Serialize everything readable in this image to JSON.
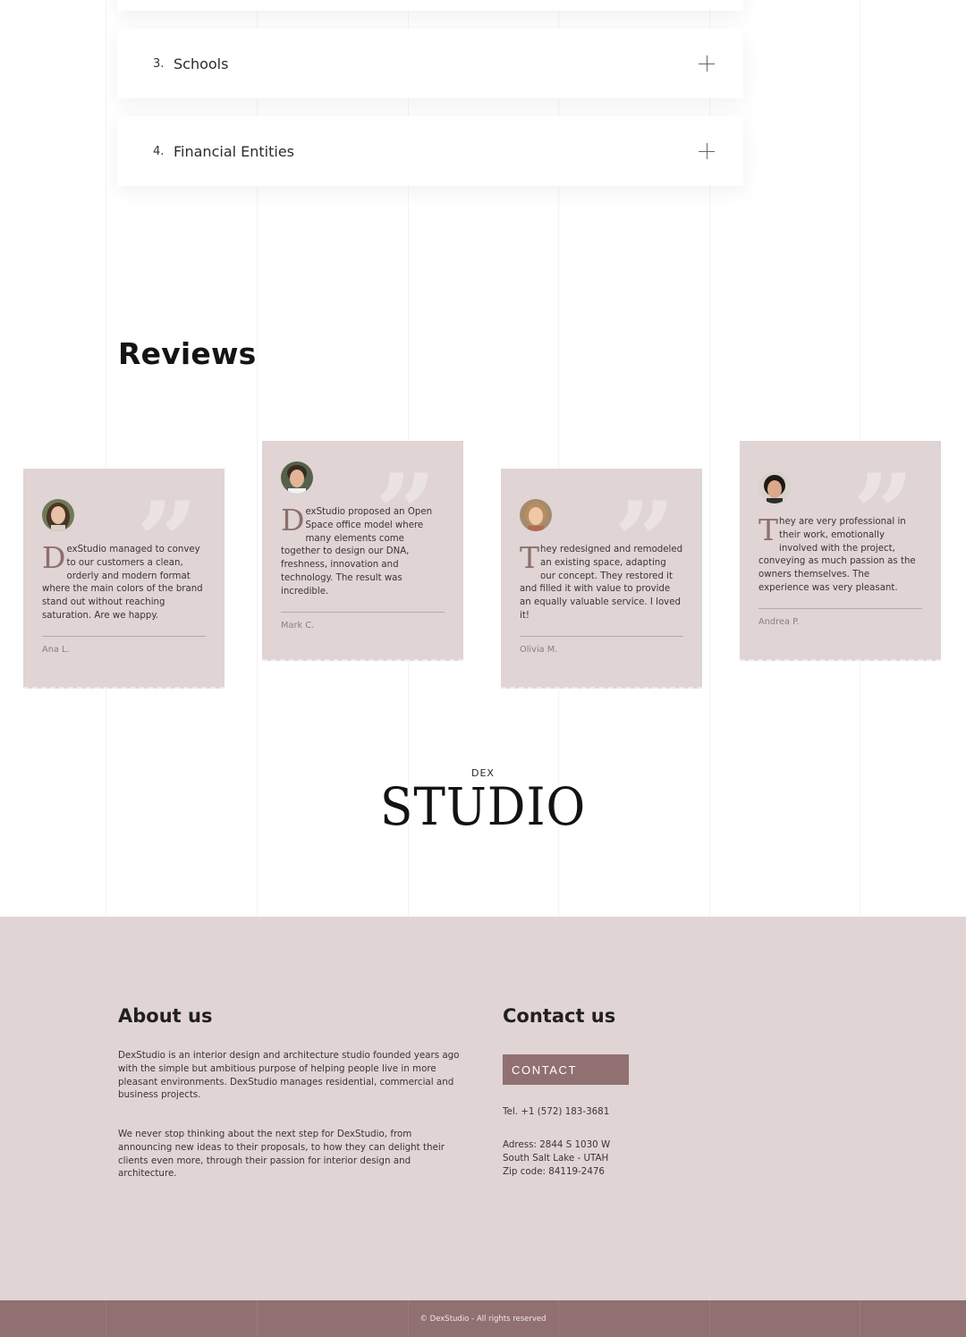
{
  "accordion": {
    "items": [
      {
        "number": "3.",
        "title": "Schools"
      },
      {
        "number": "4.",
        "title": "Financial Entities"
      }
    ]
  },
  "reviews": {
    "title": "Reviews",
    "items": [
      {
        "dropcap": "D",
        "text": "exStudio managed to convey to our customers a clean, orderly and modern format where the main colors of the brand stand out without reaching saturation. Are we happy.",
        "author": "Ana L."
      },
      {
        "dropcap": "D",
        "text": "exStudio proposed an Open Space office model where many elements come together to design our DNA, freshness, innovation and technology. The result was incredible.",
        "author": "Mark C."
      },
      {
        "dropcap": "T",
        "text": "hey redesigned and remodeled an existing space, adapting our concept. They restored it and filled it with value to provide an equally valuable service. I loved it!",
        "author": "Olivia M."
      },
      {
        "dropcap": "T",
        "text": "hey are very professional in their work, emotionally involved with the project, conveying as much passion as the owners themselves. The experience was very pleasant.",
        "author": "Andrea P."
      }
    ]
  },
  "logo": {
    "small": "DEX",
    "big": "STUDIO"
  },
  "footer": {
    "about_title": "About us",
    "about_p1": "DexStudio is an interior design and architecture studio founded years ago with the simple but ambitious purpose of helping people live in more pleasant environments. DexStudio manages residential, commercial and business projects.",
    "about_p2": "We never stop thinking about the next step for DexStudio, from announcing new ideas to their proposals, to how they can delight their clients even more, through their passion for interior design and architecture.",
    "contact_title": "Contact us",
    "contact_button": "CONTACT",
    "tel": "Tel. +1 (572) 183-3681",
    "address_line1": "Adress: 2844 S 1030 W",
    "address_line2": "South Salt Lake - UTAH",
    "address_line3": "Zip code: 84119-2476"
  },
  "copyright": "© DexStudio - All rights reserved",
  "colors": {
    "card_bg": "#e0d4d4",
    "accent": "#917072",
    "text": "#3a3535"
  }
}
